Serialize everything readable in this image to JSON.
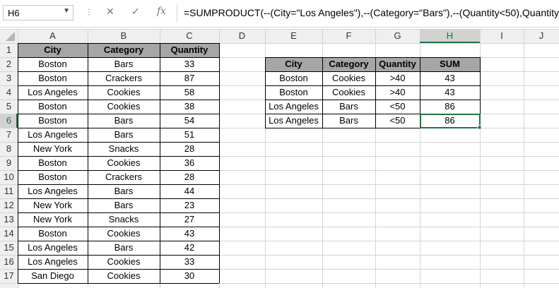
{
  "name_box": "H6",
  "formula": "=SUMPRODUCT(--(City=\"Los Angeles\"),--(Category=\"Bars\"),--(Quantity<50),Quantity)",
  "columns": [
    "A",
    "B",
    "C",
    "D",
    "E",
    "F",
    "G",
    "H",
    "I",
    "J"
  ],
  "rows": [
    "1",
    "2",
    "3",
    "4",
    "5",
    "6",
    "7",
    "8",
    "9",
    "10",
    "11",
    "12",
    "13",
    "14",
    "15",
    "16",
    "17"
  ],
  "data_headers": [
    "City",
    "Category",
    "Quantity"
  ],
  "data_rows": [
    [
      "Boston",
      "Bars",
      "33"
    ],
    [
      "Boston",
      "Crackers",
      "87"
    ],
    [
      "Los Angeles",
      "Cookies",
      "58"
    ],
    [
      "Boston",
      "Cookies",
      "38"
    ],
    [
      "Boston",
      "Bars",
      "54"
    ],
    [
      "Los Angeles",
      "Bars",
      "51"
    ],
    [
      "New York",
      "Snacks",
      "28"
    ],
    [
      "Boston",
      "Cookies",
      "36"
    ],
    [
      "Boston",
      "Crackers",
      "28"
    ],
    [
      "Los Angeles",
      "Bars",
      "44"
    ],
    [
      "New York",
      "Bars",
      "23"
    ],
    [
      "New York",
      "Snacks",
      "27"
    ],
    [
      "Boston",
      "Cookies",
      "43"
    ],
    [
      "Los Angeles",
      "Bars",
      "42"
    ],
    [
      "Los Angeles",
      "Cookies",
      "33"
    ],
    [
      "San Diego",
      "Cookies",
      "30"
    ]
  ],
  "crit_headers": [
    "City",
    "Category",
    "Quantity",
    "SUM"
  ],
  "crit_rows": [
    [
      "Boston",
      "Cookies",
      ">40",
      "43"
    ],
    [
      "Boston",
      "Cookies",
      ">40",
      "43"
    ],
    [
      "Los Angeles",
      "Bars",
      "<50",
      "86"
    ],
    [
      "Los Angeles",
      "Bars",
      "<50",
      "86"
    ]
  ],
  "colors": {
    "header_fill": "#a6a6a6",
    "selected": "#217346",
    "grid": "#d4d4d4"
  }
}
